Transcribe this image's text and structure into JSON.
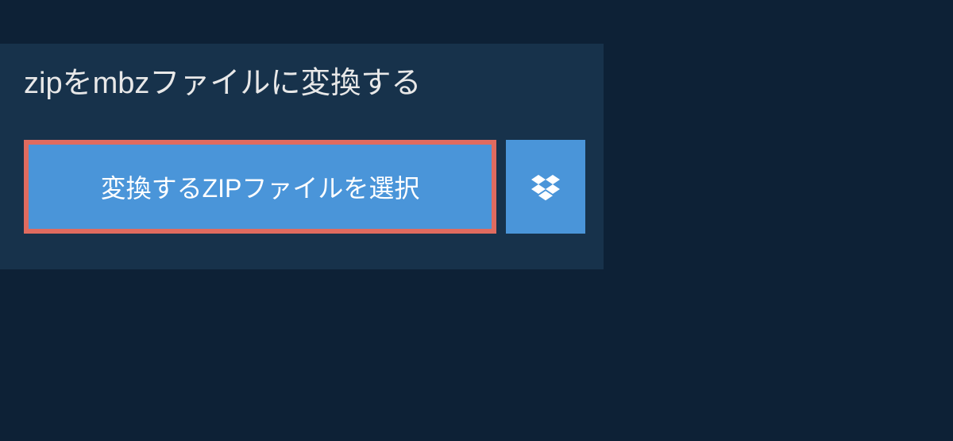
{
  "header": {
    "title": "zipをmbzファイルに変換する"
  },
  "actions": {
    "select_file_label": "変換するZIPファイルを選択",
    "dropbox_icon_name": "dropbox-icon"
  },
  "colors": {
    "background": "#0d2136",
    "panel": "#17324b",
    "button_primary": "#4a95d9",
    "button_border": "#e06b5f",
    "text_light": "#ffffff"
  }
}
